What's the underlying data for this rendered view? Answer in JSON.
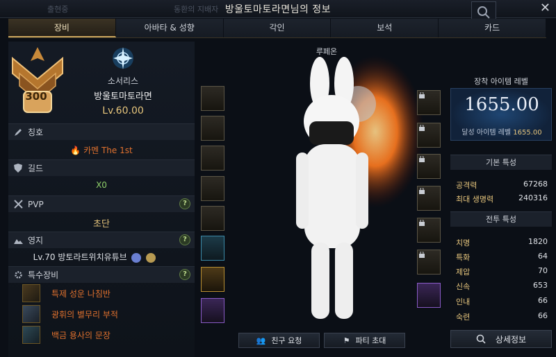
{
  "window": {
    "title": "방울토마토라면님의 정보",
    "ghost_left": "출현중",
    "ghost_mid": "동환의 지배자"
  },
  "tabs": [
    "장비",
    "아바타 & 성향",
    "각인",
    "보석",
    "카드"
  ],
  "profile": {
    "rank": "300",
    "class": "소서리스",
    "name": "방울토마토라면",
    "level": "Lv.60.00"
  },
  "sections": {
    "title": {
      "label": "칭호",
      "value": "카멘 The 1st"
    },
    "guild": {
      "label": "길드",
      "value": "X0"
    },
    "pvp": {
      "label": "PVP",
      "value": "초단"
    },
    "estate": {
      "label": "영지",
      "value": "Lv.70 방토라트위치유튜브"
    },
    "special": {
      "label": "특수장비",
      "items": [
        "특제 성운 나침반",
        "광휘의 별무리 부적",
        "백금 용사의 문장"
      ]
    }
  },
  "center": {
    "title": "루페온",
    "friend_button": "친구 요청",
    "party_button": "파티 초대"
  },
  "right": {
    "item_level_header": "장착 아이템 레벨",
    "item_level": "1655.00",
    "achieved_label": "달성 아이템 레벨",
    "achieved_value": "1655.00",
    "basic_header": "기본 특성",
    "basic": [
      {
        "k": "공격력",
        "v": "67268"
      },
      {
        "k": "최대 생명력",
        "v": "240316"
      }
    ],
    "combat_header": "전투 특성",
    "combat": [
      {
        "k": "치명",
        "v": "1820"
      },
      {
        "k": "특화",
        "v": "64"
      },
      {
        "k": "제압",
        "v": "70"
      },
      {
        "k": "신속",
        "v": "653"
      },
      {
        "k": "인내",
        "v": "66"
      },
      {
        "k": "숙련",
        "v": "66"
      }
    ],
    "detail_button": "상세정보"
  },
  "colors": {
    "gold": "#e6c57c",
    "orange": "#e0712e",
    "green": "#8fd06a",
    "tab_active": "#c9a55d"
  }
}
